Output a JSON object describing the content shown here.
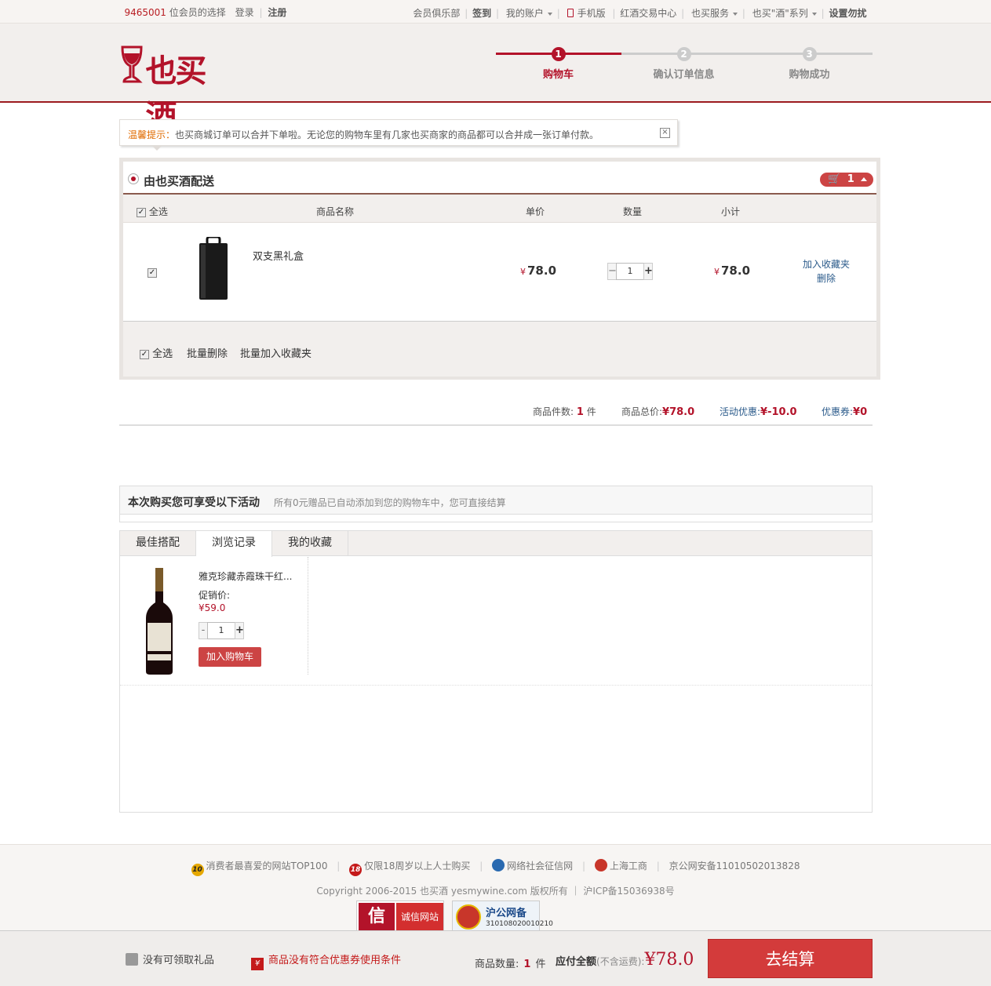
{
  "topbar": {
    "member_count": "9465001",
    "member_suffix": "位会员的选择",
    "login": "登录",
    "register": "注册",
    "links": [
      "会员俱乐部",
      "签到",
      "我的账户",
      "手机版",
      "红酒交易中心",
      "也买服务",
      "也买\"酒\"系列",
      "设置勿扰"
    ]
  },
  "header": {
    "logo_text": "也买酒",
    "steps": [
      {
        "num": "1",
        "label": "购物车",
        "active": true
      },
      {
        "num": "2",
        "label": "确认订单信息",
        "active": false
      },
      {
        "num": "3",
        "label": "购物成功",
        "active": false
      }
    ]
  },
  "notice": {
    "prefix": "温馨提示：",
    "text": "也买商城订单可以合并下单啦。无论您的购物车里有几家也买商家的商品都可以合并成一张订单付款。"
  },
  "cart": {
    "ship_title": "由也买酒配送",
    "badge_count": "1",
    "columns": {
      "select_all": "全选",
      "name": "商品名称",
      "unit_price": "单价",
      "qty": "数量",
      "subtotal": "小计"
    },
    "items": [
      {
        "name": "双支黑礼盒",
        "currency": "¥",
        "price": "78.0",
        "qty": "1",
        "subtotal": "78.0",
        "op_fav": "加入收藏夹",
        "op_del": "删除"
      }
    ],
    "actions": {
      "select_all": "全选",
      "batch_delete": "批量删除",
      "batch_fav": "批量加入收藏夹"
    }
  },
  "summary": {
    "count_label": "商品件数:",
    "count": "1",
    "count_unit": "件",
    "total_label": "商品总价:",
    "total": "¥78.0",
    "promo_label": "活动优惠:",
    "promo": "¥-10.0",
    "coupon_label": "优惠券:",
    "coupon": "¥0"
  },
  "activity": {
    "title": "本次购买您可享受以下活动",
    "subtitle": "所有0元赠品已自动添加到您的购物车中，您可直接结算"
  },
  "tabs": {
    "items": [
      "最佳搭配",
      "浏览记录",
      "我的收藏"
    ],
    "active_index": 1,
    "product": {
      "name": "雅克珍藏赤霞珠干红...",
      "price_label": "促销价:",
      "price": "¥59.0",
      "qty": "1",
      "qty_minus": "-",
      "qty_plus": "+",
      "add_btn": "加入购物车"
    }
  },
  "footer": {
    "links": [
      {
        "icon": "10",
        "text": "消费者最喜爱的网站TOP100"
      },
      {
        "icon": "18",
        "text": "仅限18周岁以上人士购买"
      },
      {
        "icon": "",
        "text": "网络社会征信网"
      },
      {
        "icon": "",
        "text": "上海工商"
      },
      {
        "icon": "",
        "text": "京公网安备11010502013828"
      }
    ],
    "copyright": "Copyright 2006-2015 也买酒 yesmywine.com 版权所有 ｜ 沪ICP备15036938号",
    "badge_credit_left": "信",
    "badge_credit_right": "诚信网站",
    "badge_police_title": "沪公网备",
    "badge_police_num": "310108020010210"
  },
  "bottombar": {
    "gift": "没有可领取礼品",
    "coupon": "商品没有符合优惠券使用条件",
    "count_label": "商品数量:",
    "count": "1",
    "count_unit": "件",
    "payable_label": "应付全额",
    "no_shipping": "(不含运费):",
    "amount": "¥78.0",
    "checkout": "去结算"
  },
  "colors": {
    "brand": "#b3132a",
    "link": "#2a5a8a",
    "checkout": "#d33b3b"
  }
}
